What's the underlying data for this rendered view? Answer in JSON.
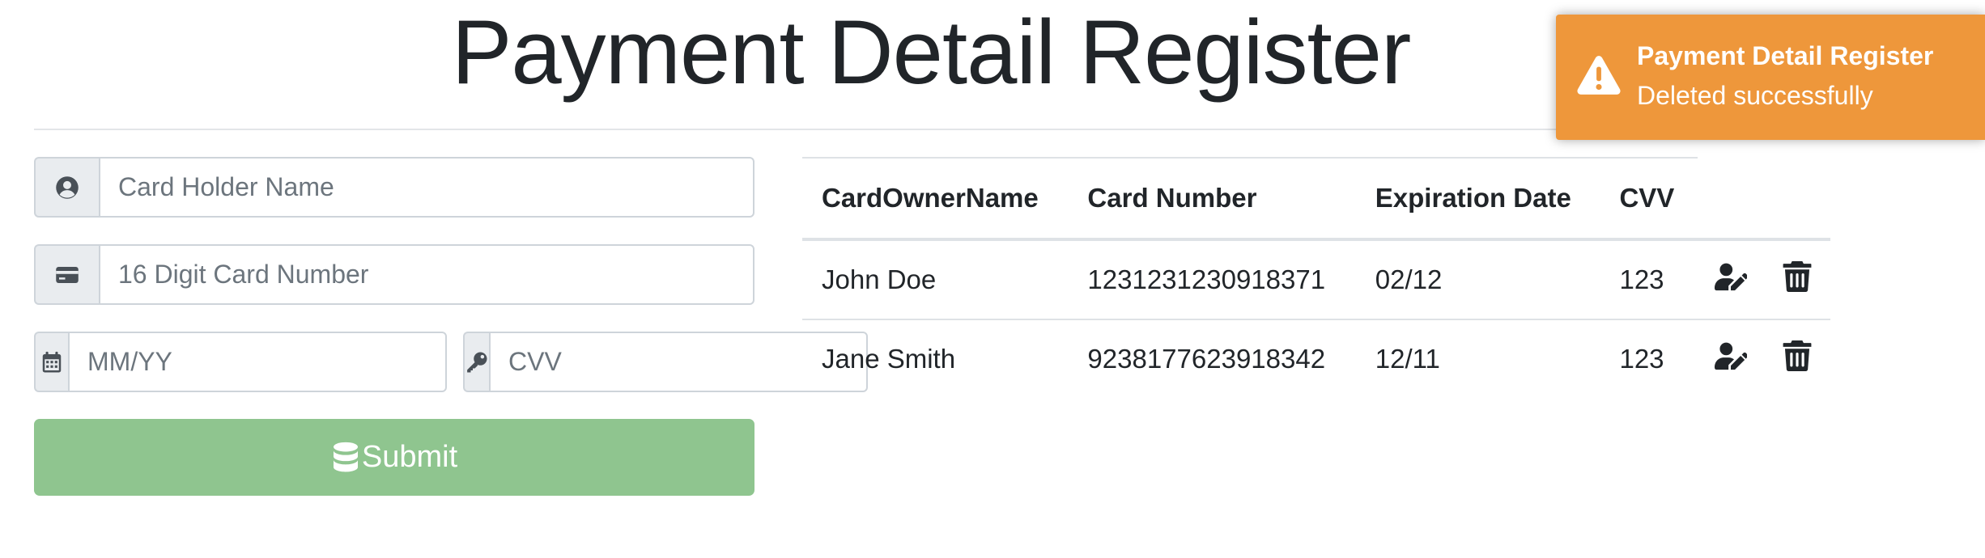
{
  "page": {
    "title": "Payment Detail Register"
  },
  "form": {
    "card_holder_placeholder": "Card Holder Name",
    "card_number_placeholder": "16 Digit Card Number",
    "expiry_placeholder": "MM/YY",
    "cvv_placeholder": "CVV",
    "submit_label": "Submit",
    "icons": {
      "card_holder": "user-circle-icon",
      "card_number": "credit-card-icon",
      "expiry": "calendar-icon",
      "cvv": "key-icon",
      "submit": "database-icon"
    },
    "submit_color": "#8fc58f"
  },
  "table": {
    "columns": [
      "CardOwnerName",
      "Card Number",
      "Expiration Date",
      "CVV"
    ],
    "rows": [
      {
        "owner": "John Doe",
        "number": "1231231230918371",
        "expiry": "02/12",
        "cvv": "123"
      },
      {
        "owner": "Jane Smith",
        "number": "9238177623918342",
        "expiry": "12/11",
        "cvv": "123"
      }
    ],
    "row_actions": [
      "user-edit-icon",
      "trash-icon"
    ]
  },
  "toast": {
    "title": "Payment Detail Register",
    "message": "Deleted successfully",
    "icon": "warning-icon",
    "color": "#ee973b"
  }
}
